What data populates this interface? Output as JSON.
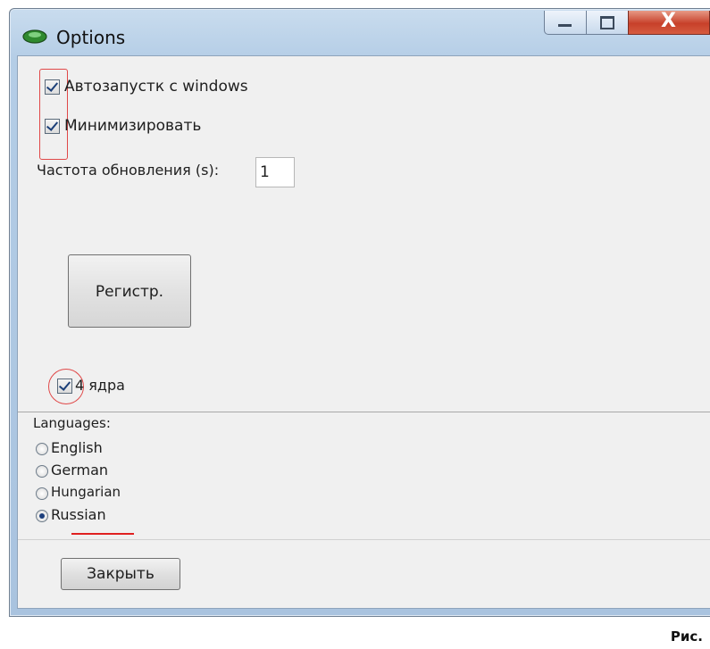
{
  "window": {
    "title": "Options"
  },
  "settings": {
    "autostart": {
      "label": "Автозапустк с windows",
      "checked": true
    },
    "minimize": {
      "label": "Минимизировать",
      "checked": true
    },
    "frequency_label": "Частота обновления (s):",
    "frequency_value": "1",
    "register_button": "Регистр.",
    "cores": {
      "label": "4 ядра",
      "checked": true
    }
  },
  "languages": {
    "title": "Languages:",
    "options": [
      {
        "label": "English",
        "selected": false
      },
      {
        "label": "German",
        "selected": false
      },
      {
        "label": "Hungarian",
        "selected": false
      },
      {
        "label": "Russian",
        "selected": true
      }
    ]
  },
  "footer": {
    "close_button": "Закрыть"
  },
  "caption": "Рис.",
  "colors": {
    "annotation_red": "#e04848",
    "title_bar": "#b4cde6",
    "close_red": "#c7402a"
  }
}
